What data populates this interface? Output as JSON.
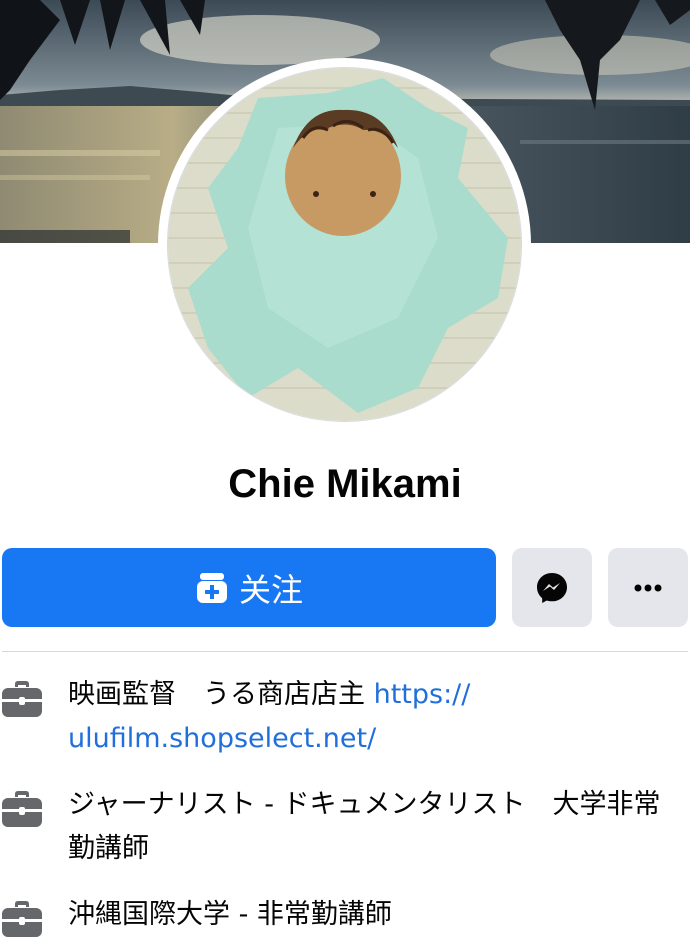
{
  "profile": {
    "name": "Chie Mikami"
  },
  "actions": {
    "follow_label": "关注",
    "follow_icon": "follow-box-icon",
    "messenger_icon": "messenger-icon",
    "more_icon": "more-dots-icon"
  },
  "colors": {
    "primary": "#1877f2",
    "secondary_button": "#e4e6eb",
    "link": "#216fdb",
    "text": "#050505",
    "icon": "#65676b"
  },
  "info": [
    {
      "icon": "briefcase-icon",
      "text": "映画監督　うる商店店主 ",
      "link": "https://\nulufilm.shopselect.net/"
    },
    {
      "icon": "briefcase-icon",
      "text": "ジャーナリスト - ドキュメンタリスト　大学非常勤講師",
      "link": ""
    },
    {
      "icon": "briefcase-icon",
      "text": "沖縄国際大学 - 非常勤講師",
      "link": ""
    }
  ]
}
